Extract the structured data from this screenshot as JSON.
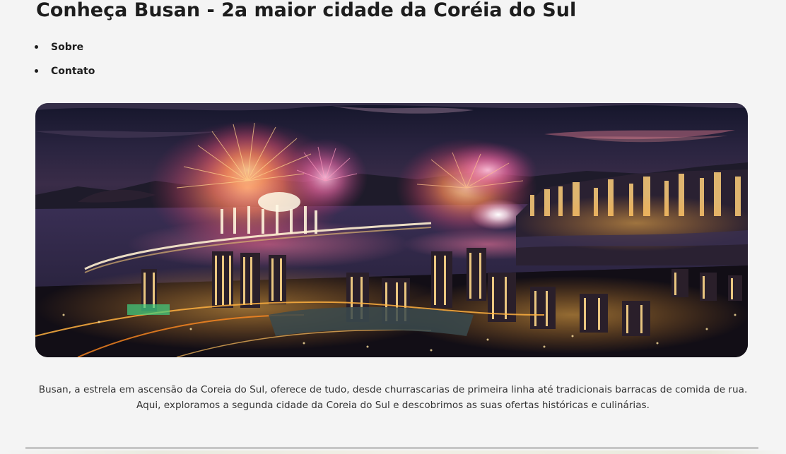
{
  "header": {
    "title": "Conheça Busan - 2a maior cidade da Coréia do Sul"
  },
  "nav": {
    "items": [
      {
        "label": "Sobre"
      },
      {
        "label": "Contato"
      }
    ]
  },
  "intro": {
    "line1": "Busan, a estrela em ascensão da Coreia do Sul, oferece de tudo, desde churrascarias de primeira linha até tradicionais barracas de comida de rua.",
    "line2": "Aqui, exploramos a segunda cidade da Coreia do Sul e descobrimos as suas ofertas históricas e culinárias."
  }
}
